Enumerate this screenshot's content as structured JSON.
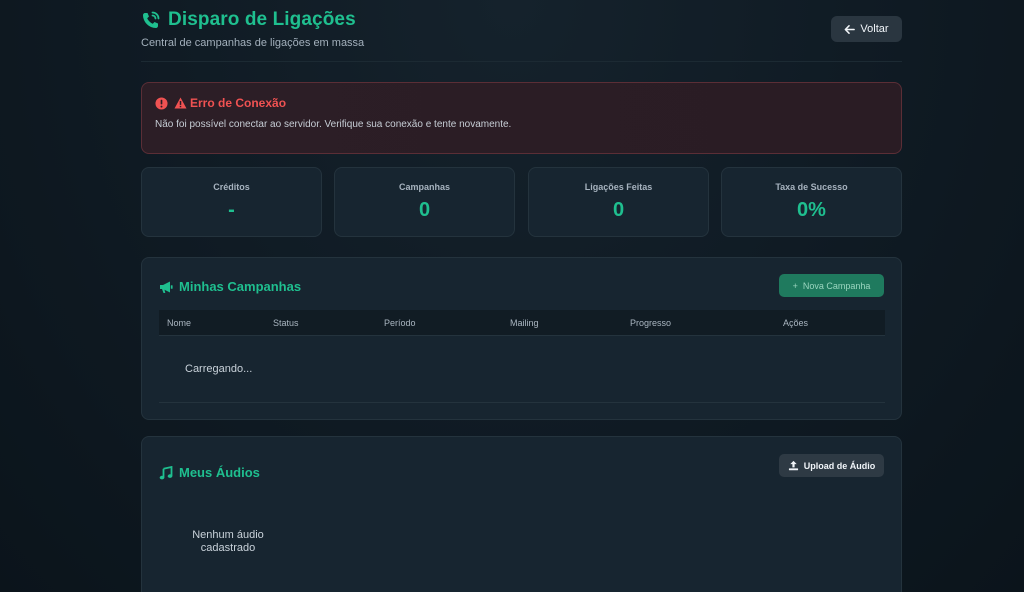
{
  "header": {
    "title": "Disparo de Ligações",
    "subtitle": "Central de campanhas de ligações em massa",
    "back_label": "Voltar"
  },
  "error": {
    "title": "Erro de Conexão",
    "message": "Não foi possível conectar ao servidor. Verifique sua conexão e tente novamente."
  },
  "stats": [
    {
      "label": "Créditos",
      "value": "-"
    },
    {
      "label": "Campanhas",
      "value": "0"
    },
    {
      "label": "Ligações Feitas",
      "value": "0"
    },
    {
      "label": "Taxa de Sucesso",
      "value": "0%"
    }
  ],
  "campaigns": {
    "title": "Minhas Campanhas",
    "new_label": "Nova Campanha",
    "columns": [
      "Nome",
      "Status",
      "Período",
      "Mailing",
      "Progresso",
      "Ações"
    ],
    "loading_text": "Carregando..."
  },
  "audios": {
    "title": "Meus Áudios",
    "upload_label": "Upload de Áudio",
    "empty_text": "Nenhum áudio cadastrado"
  },
  "colors": {
    "accent": "#1fbf8f",
    "error": "#f05252",
    "background": "#0f1a23",
    "card": "#172530"
  },
  "icons": [
    "phone-volume-icon",
    "arrow-left-icon",
    "exclamation-circle-icon",
    "warning-triangle-icon",
    "megaphone-icon",
    "plus-icon",
    "music-icon",
    "upload-icon"
  ]
}
